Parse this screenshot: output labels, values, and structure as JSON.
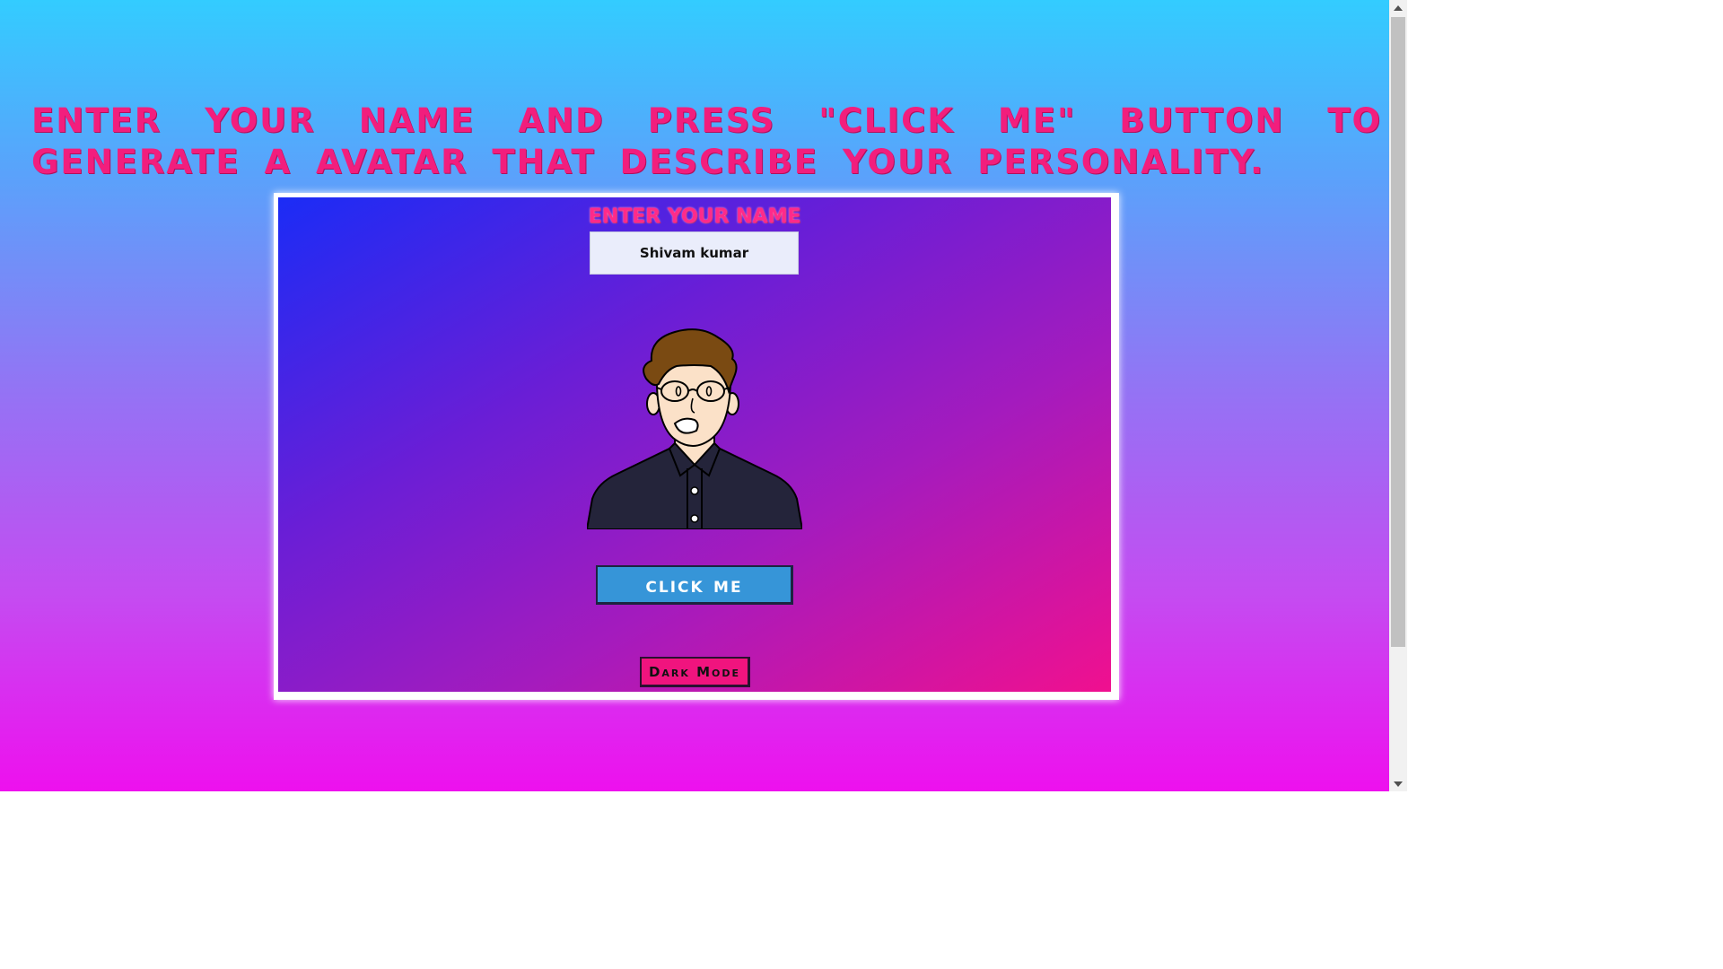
{
  "headline": "Enter your name and press \"click me\" button to generate a avatar that describe your personality.",
  "card": {
    "name_label": "ENTER YOUR NAME",
    "name_value": "Shivam kumar",
    "click_button": "Click Me",
    "dark_mode_button": "Dark Mode"
  },
  "avatar": {
    "icon": "male-avatar-with-glasses-icon"
  },
  "colors": {
    "headline": "#f21e7d",
    "click_button_bg": "#3695d8",
    "dark_mode_bg": "#f0147e",
    "page_gradient_top": "#33ccff",
    "page_gradient_bottom": "#ee10ee",
    "card_gradient_start": "#1b2cf6",
    "card_gradient_end": "#f0108f"
  },
  "scrollbar": {
    "up_icon": "scroll-up-arrow-icon",
    "down_icon": "scroll-down-arrow-icon"
  }
}
